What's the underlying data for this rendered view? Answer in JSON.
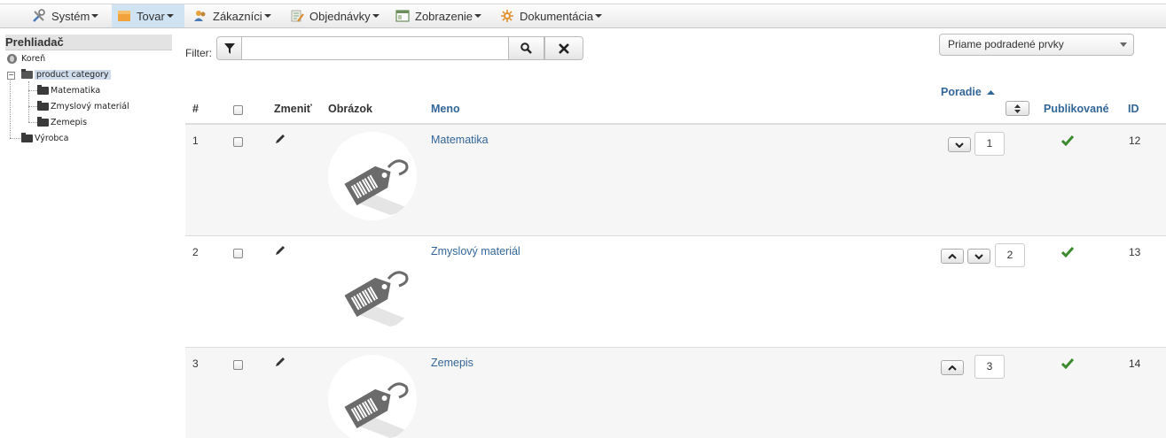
{
  "menu": {
    "items": [
      {
        "label": "Systém",
        "icon": "tools-icon"
      },
      {
        "label": "Tovar",
        "icon": "box-icon",
        "active": true
      },
      {
        "label": "Zákazníci",
        "icon": "users-icon"
      },
      {
        "label": "Objednávky",
        "icon": "orders-icon"
      },
      {
        "label": "Zobrazenie",
        "icon": "display-icon"
      },
      {
        "label": "Dokumentácia",
        "icon": "docs-icon"
      }
    ]
  },
  "sidebar": {
    "title": "Prehliadač",
    "tree": {
      "root": "Koreň",
      "selected": "product category",
      "children": [
        "Matematika",
        "Zmyslový materiál",
        "Zemepis"
      ],
      "sibling": "Výrobca"
    }
  },
  "filter": {
    "label": "Filter:",
    "value": "",
    "placeholder": ""
  },
  "view_select": {
    "selected": "Priame podradené prvky"
  },
  "table": {
    "headers": {
      "num": "#",
      "edit": "Zmeniť",
      "image": "Obrázok",
      "name": "Meno",
      "order": "Poradie",
      "published": "Publikované",
      "id": "ID"
    },
    "rows": [
      {
        "num": "1",
        "name": "Matematika",
        "order": "1",
        "id": "12",
        "published": true
      },
      {
        "num": "2",
        "name": "Zmyslový materiál",
        "order": "2",
        "id": "13",
        "published": true
      },
      {
        "num": "3",
        "name": "Zemepis",
        "order": "3",
        "id": "14",
        "published": true
      }
    ]
  },
  "colors": {
    "link": "#336699",
    "active_menu": "#cfe3f3",
    "published": "#3c8a2e"
  }
}
